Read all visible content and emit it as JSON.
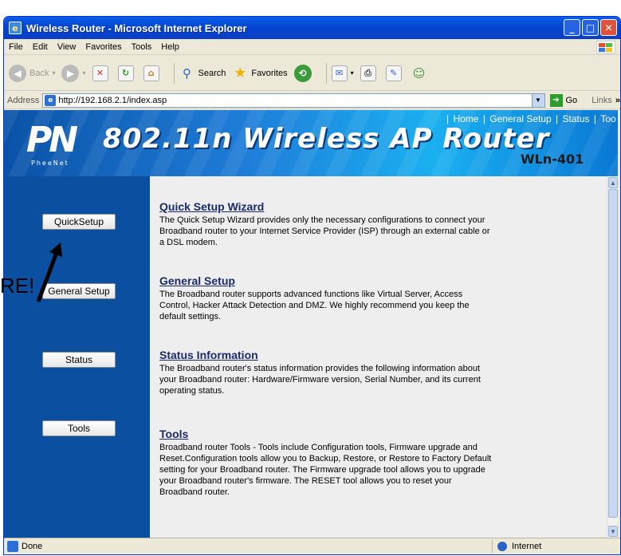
{
  "window": {
    "title": "Wireless Router - Microsoft Internet Explorer"
  },
  "menu": {
    "items": [
      "File",
      "Edit",
      "View",
      "Favorites",
      "Tools",
      "Help"
    ]
  },
  "toolbar": {
    "back_label": "Back",
    "search_label": "Search",
    "favorites_label": "Favorites"
  },
  "address": {
    "label": "Address",
    "url": "http://192.168.2.1/index.asp",
    "go_label": "Go",
    "links_label": "Links"
  },
  "banner": {
    "headline": "802.11n Wireless AP Router",
    "model": "WLn-401",
    "brand": "PheeNet",
    "top_links": [
      "Home",
      "General Setup",
      "Status",
      "Too"
    ]
  },
  "sidebar": {
    "buttons": [
      "QuickSetup",
      "General Setup",
      "Status",
      "Tools"
    ]
  },
  "sections": [
    {
      "title": "Quick Setup Wizard",
      "body": "The Quick Setup Wizard provides only the necessary configurations to connect your Broadband router to your Internet Service Provider (ISP) through an external cable or a DSL modem."
    },
    {
      "title": "General Setup",
      "body": "The Broadband router supports advanced functions like Virtual Server, Access Control, Hacker Attack Detection and DMZ. We highly recommend you keep the default settings."
    },
    {
      "title": "Status Information",
      "body": "The Broadband router's status information provides the following information about your Broadband router: Hardware/Firmware version, Serial Number, and its current operating status."
    },
    {
      "title": "Tools",
      "body": "Broadband router Tools - Tools include Configuration tools, Firmware upgrade and Reset.Configuration tools allow you to Backup, Restore, or Restore to Factory Default setting for your Broadband router. The Firmware upgrade tool allows you to upgrade your Broadband router's firmware. The RESET tool allows you to reset your Broadband router."
    }
  ],
  "status": {
    "left": "Done",
    "zone": "Internet"
  },
  "annotation": {
    "text": "RE!"
  }
}
